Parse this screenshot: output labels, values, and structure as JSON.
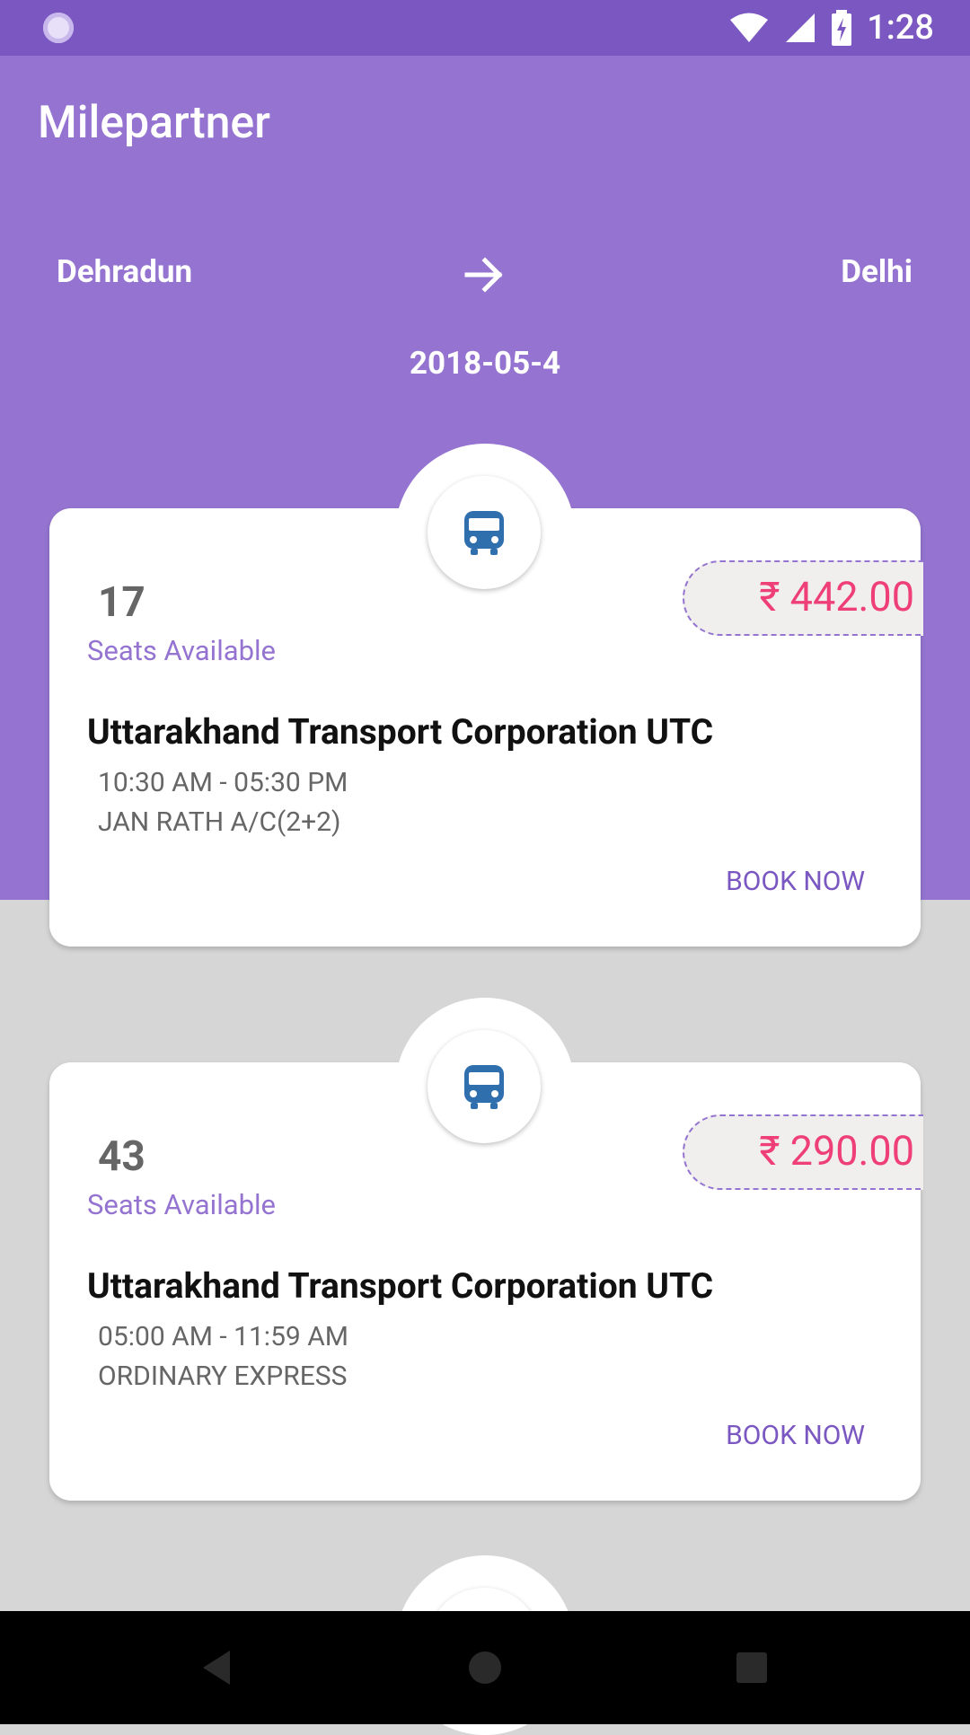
{
  "status_bar": {
    "time": "1:28"
  },
  "app_bar": {
    "title": "Milepartner"
  },
  "route": {
    "from": "Dehradun",
    "to": "Delhi",
    "date": "2018-05-4"
  },
  "colors": {
    "primary": "#9474d0",
    "primary_dark": "#7b57c1",
    "price": "#ee3f76",
    "bus_icon": "#2f6fae"
  },
  "buses": [
    {
      "seats": "17",
      "seats_label": "Seats Available",
      "price": "₹ 442.00",
      "operator": "Uttarakhand Transport Corporation UTC",
      "timing": "10:30 AM - 05:30 PM",
      "type": "JAN RATH A/C(2+2)",
      "action": "BOOK NOW"
    },
    {
      "seats": "43",
      "seats_label": "Seats Available",
      "price": "₹ 290.00",
      "operator": "Uttarakhand Transport Corporation UTC",
      "timing": "05:00 AM - 11:59 AM",
      "type": "ORDINARY EXPRESS",
      "action": "BOOK NOW"
    }
  ],
  "icons": [
    "app-status-icon",
    "wifi-icon",
    "signal-icon",
    "battery-charging-icon",
    "arrow-right-icon",
    "bus-icon",
    "back-icon",
    "home-icon",
    "recents-icon"
  ]
}
